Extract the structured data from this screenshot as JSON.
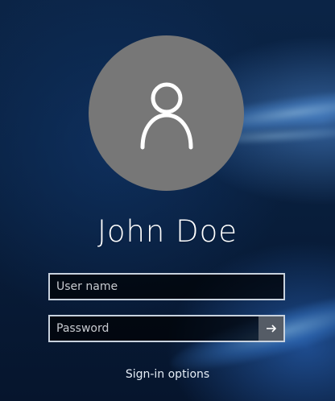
{
  "user": {
    "display_name": "John Doe",
    "avatar_icon": "person-icon"
  },
  "form": {
    "username_placeholder": "User name",
    "password_placeholder": "Password",
    "submit_icon": "arrow-right-icon"
  },
  "links": {
    "signin_options": "Sign-in options"
  },
  "colors": {
    "avatar_bg": "#777777",
    "field_border": "#c8d2de",
    "submit_button_bg": "#555c66"
  }
}
